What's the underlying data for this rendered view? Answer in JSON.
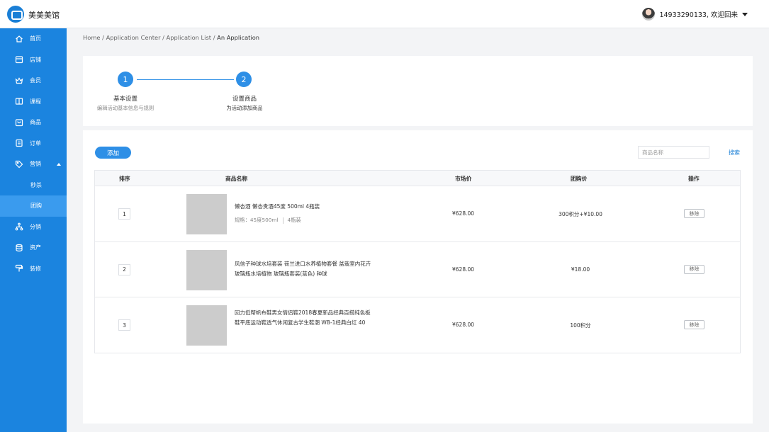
{
  "header": {
    "brand": "美美美馆",
    "user_text": "14933290133, 欢迎回来"
  },
  "sidebar": {
    "items": [
      {
        "label": "首页",
        "icon": "home-icon"
      },
      {
        "label": "店铺",
        "icon": "store-icon"
      },
      {
        "label": "会员",
        "icon": "member-icon"
      },
      {
        "label": "课程",
        "icon": "book-icon"
      },
      {
        "label": "商品",
        "icon": "goods-icon"
      },
      {
        "label": "订单",
        "icon": "order-icon"
      },
      {
        "label": "营销",
        "icon": "tag-icon"
      },
      {
        "label": "秒杀"
      },
      {
        "label": "团购"
      },
      {
        "label": "分销",
        "icon": "distribution-icon"
      },
      {
        "label": "资产",
        "icon": "asset-icon"
      },
      {
        "label": "装修",
        "icon": "decoration-icon"
      }
    ]
  },
  "breadcrumb": {
    "path": "Home / Application Center / Application List  /",
    "current": " An Application"
  },
  "steps": [
    {
      "number": "1",
      "title": "基本设置",
      "subtitle": "编辑活动基本信息与规则"
    },
    {
      "number": "2",
      "title": "设置商品",
      "subtitle": "为活动添加商品"
    }
  ],
  "toolbar": {
    "add_label": "添加",
    "search_placeholder": "商品名称",
    "search_label": "搜索"
  },
  "table": {
    "headers": {
      "order": "排序",
      "name": "商品名称",
      "market_price": "市场价",
      "group_price": "团购价",
      "action": "操作"
    },
    "rows": [
      {
        "index": "1",
        "name": "懒杏酒 懒杏贵酒45度 500ml 4瓶装",
        "spec_label": "规格：45度500ml",
        "spec_count": "4瓶装",
        "market_price": "¥628.00",
        "group_price": "300积分+¥10.00",
        "action": "移除"
      },
      {
        "index": "2",
        "name": "风信子种球水培套装 荷兰进口水养植物套餐 盆栽室内花卉玻璃瓶水培植物 玻璃瓶套装(蓝色) 种球",
        "market_price": "¥628.00",
        "group_price": "¥18.00",
        "action": "移除"
      },
      {
        "index": "3",
        "name": "回力低帮帆布鞋男女情侣鞋2018春夏新品经典百搭纯色板鞋平底运动鞋透气休闲复古学生鞋潮 WB-1经典白红 40",
        "market_price": "¥628.00",
        "group_price": "100积分",
        "action": "移除"
      }
    ]
  }
}
